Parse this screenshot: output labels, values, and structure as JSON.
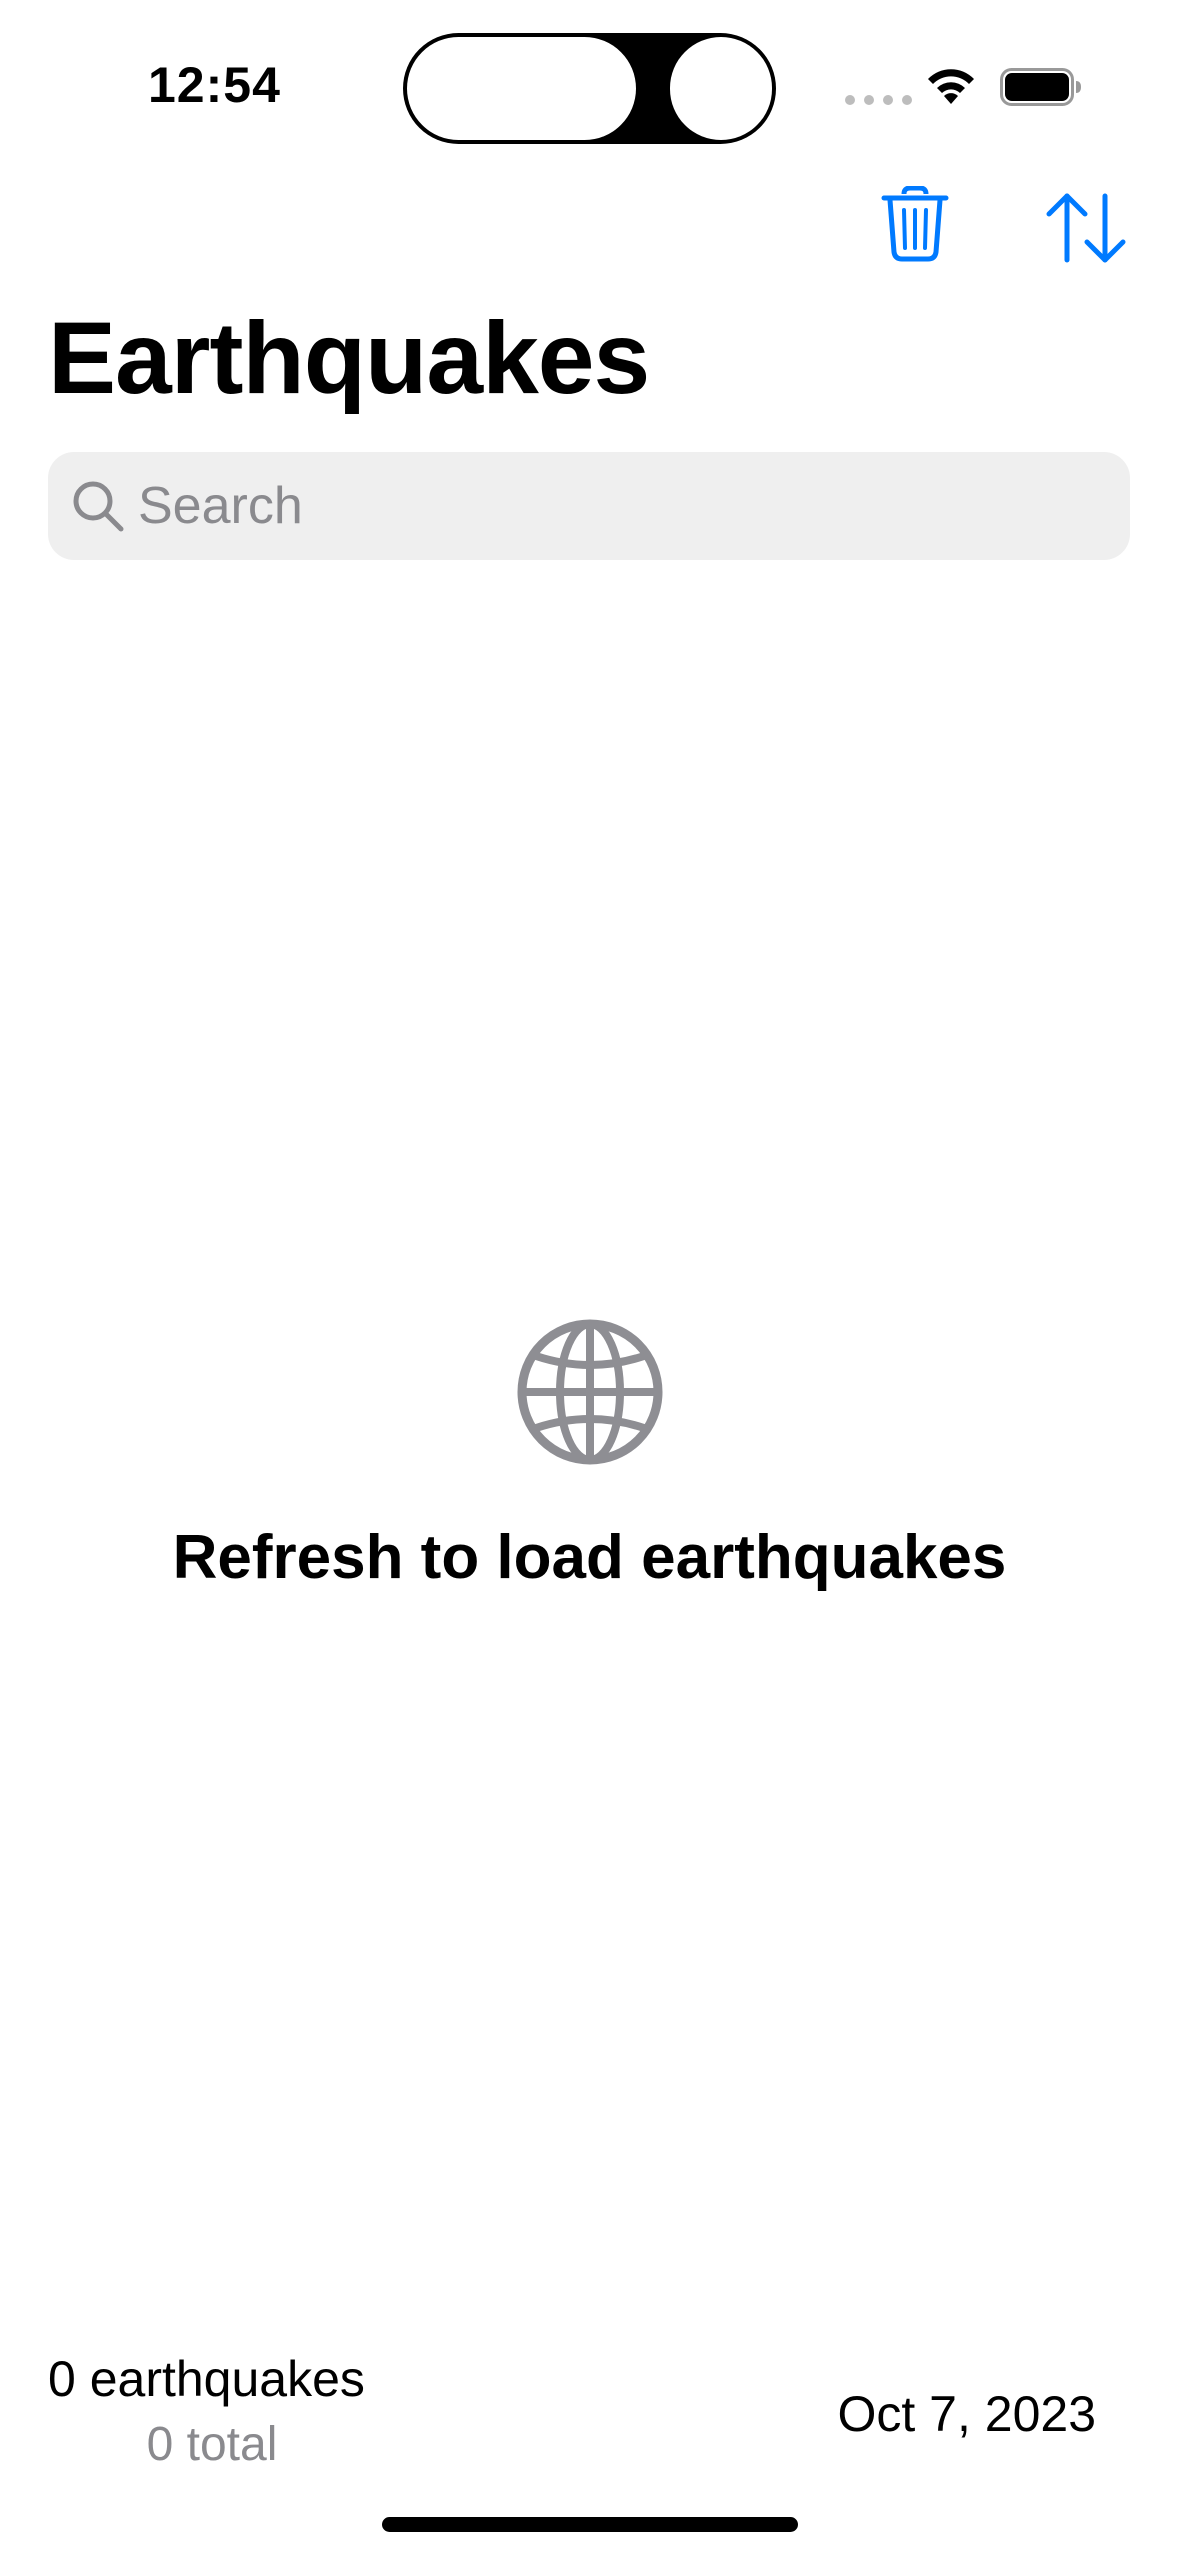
{
  "status_bar": {
    "time": "12:54",
    "icons": [
      "signal-icon",
      "wifi-icon",
      "battery-icon"
    ]
  },
  "toolbar": {
    "buttons": [
      {
        "name": "delete",
        "icon": "trash-icon"
      },
      {
        "name": "sort",
        "icon": "sort-arrows-icon"
      }
    ],
    "accent_color": "#007aff"
  },
  "header": {
    "title": "Earthquakes"
  },
  "search": {
    "placeholder": "Search",
    "value": ""
  },
  "empty_state": {
    "icon": "globe-icon",
    "icon_color": "#8e8e93",
    "message": "Refresh to load earthquakes"
  },
  "footer": {
    "count": "0 earthquakes",
    "total": "0 total",
    "date": "Oct 7, 2023"
  }
}
